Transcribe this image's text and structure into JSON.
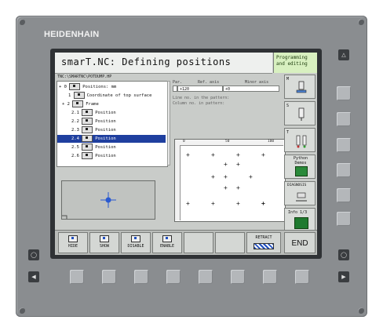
{
  "brand": "HEIDENHAIN",
  "title": "smarT.NC: Defining positions",
  "mode": {
    "line1": "Programming",
    "line2": "and editing"
  },
  "path": "TNC:\\SMARTNC\\POTDUMP.HP",
  "tree": [
    {
      "indent": "+ 0",
      "label": "Positions: mm",
      "selected": false
    },
    {
      "indent": "1",
      "label": "Coordinate of top surface",
      "selected": false
    },
    {
      "indent": "+ 2",
      "label": "Frame",
      "selected": false
    },
    {
      "indent": "2.1",
      "label": "Position",
      "selected": false
    },
    {
      "indent": "2.2",
      "label": "Position",
      "selected": false
    },
    {
      "indent": "2.3",
      "label": "Position",
      "selected": false
    },
    {
      "indent": "2.4",
      "label": "Position",
      "selected": true
    },
    {
      "indent": "2.5",
      "label": "Position",
      "selected": false
    },
    {
      "indent": "2.6",
      "label": "Position",
      "selected": false
    }
  ],
  "table": {
    "head1": "Par.",
    "head2": "Ref. axis",
    "head3": "Minor axis",
    "val1": "+120",
    "val2": "+0",
    "hint1": "Line no. in the pattern:",
    "hint2": "Column no. in pattern:"
  },
  "graph": {
    "tick": "0",
    "tick2": "50",
    "tick3": "100"
  },
  "right_softkeys": [
    {
      "label": "M"
    },
    {
      "label": "S"
    },
    {
      "label": "T"
    },
    {
      "label": "Python Demos"
    },
    {
      "label": "DIAGNOSIS"
    },
    {
      "label": "Info 1/3"
    }
  ],
  "softkeys": [
    {
      "label": "HIDE"
    },
    {
      "label": "SHOW"
    },
    {
      "label": "DISABLE"
    },
    {
      "label": "ENABLE"
    },
    {
      "label": ""
    },
    {
      "label": ""
    },
    {
      "label": "RETRACT"
    }
  ],
  "end_label": "END",
  "colors": {
    "selection": "#1f3f9f",
    "mode_bg": "#d8f0c0",
    "python": "#2a8a3a",
    "info": "#1f7a2f"
  }
}
